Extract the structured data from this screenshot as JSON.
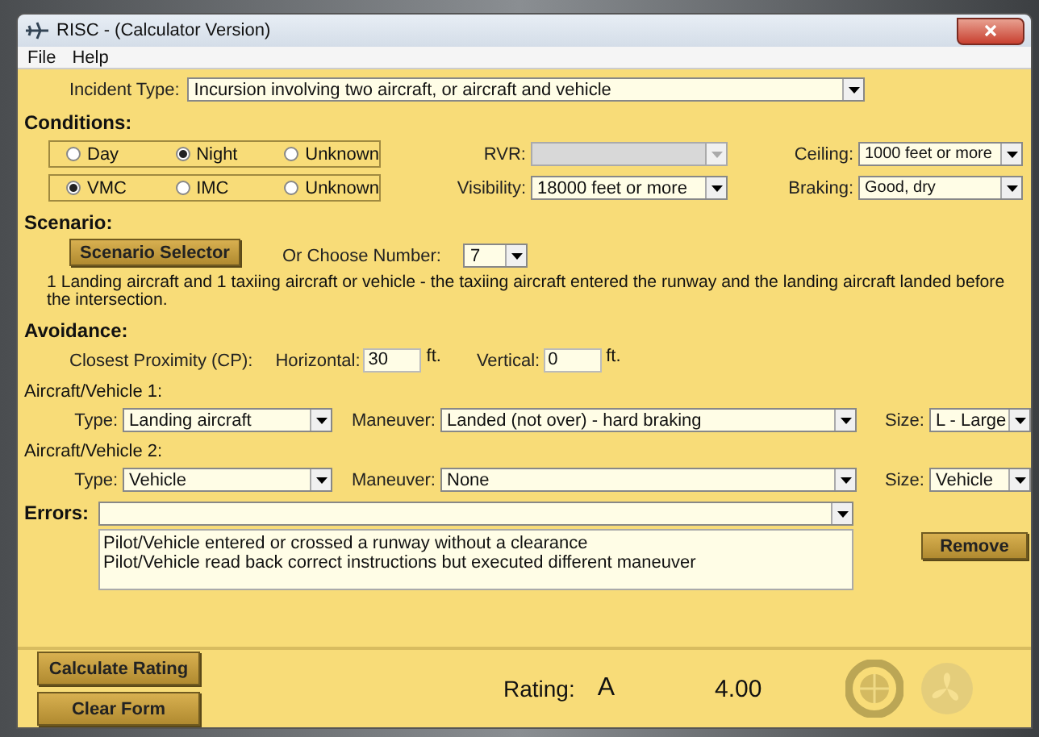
{
  "window": {
    "title": "RISC - (Calculator Version)"
  },
  "menu": [
    {
      "label": "File"
    },
    {
      "label": "Help"
    }
  ],
  "incident_type": {
    "label": "Incident Type:",
    "value": "Incursion involving two aircraft, or aircraft and vehicle"
  },
  "conditions": {
    "heading": "Conditions:",
    "light": [
      {
        "label": "Day",
        "selected": false
      },
      {
        "label": "Night",
        "selected": true
      },
      {
        "label": "Unknown",
        "selected": false
      }
    ],
    "weather": [
      {
        "label": "VMC",
        "selected": true
      },
      {
        "label": "IMC",
        "selected": false
      },
      {
        "label": "Unknown",
        "selected": false
      }
    ],
    "rvr": {
      "label": "RVR:",
      "disabled": true
    },
    "visibility": {
      "label": "Visibility:",
      "value": "18000 feet or more"
    },
    "ceiling": {
      "label": "Ceiling:",
      "value": "1000 feet or more"
    },
    "braking": {
      "label": "Braking:",
      "value": "Good, dry"
    }
  },
  "scenario": {
    "heading": "Scenario:",
    "button": "Scenario Selector",
    "number_label": "Or Choose Number:",
    "number": "7",
    "description": "1 Landing aircraft and 1 taxiing aircraft or vehicle - the taxiing aircraft entered the runway and the landing aircraft landed before the intersection."
  },
  "avoidance": {
    "heading": "Avoidance:",
    "cp_label": "Closest Proximity (CP):",
    "horizontal": {
      "label": "Horizontal:",
      "value": "30",
      "unit": "ft."
    },
    "vertical": {
      "label": "Vertical:",
      "value": "0",
      "unit": "ft."
    }
  },
  "vehicles": [
    {
      "heading": "Aircraft/Vehicle 1:",
      "type": {
        "label": "Type:",
        "value": "Landing aircraft"
      },
      "maneuver": {
        "label": "Maneuver:",
        "value": "Landed (not over) - hard braking"
      },
      "size": {
        "label": "Size:",
        "value": "L - Large"
      }
    },
    {
      "heading": "Aircraft/Vehicle 2:",
      "type": {
        "label": "Type:",
        "value": "Vehicle"
      },
      "maneuver": {
        "label": "Maneuver:",
        "value": "None"
      },
      "size": {
        "label": "Size:",
        "value": "Vehicle"
      }
    }
  ],
  "errors": {
    "heading": "Errors:",
    "items": [
      "Pilot/Vehicle entered or crossed a runway without a clearance",
      "Pilot/Vehicle read back correct instructions but executed different maneuver"
    ],
    "remove": "Remove"
  },
  "footer": {
    "calculate": "Calculate Rating",
    "clear": "Clear Form",
    "rating_label": "Rating:",
    "rating": "A",
    "score": "4.00"
  }
}
